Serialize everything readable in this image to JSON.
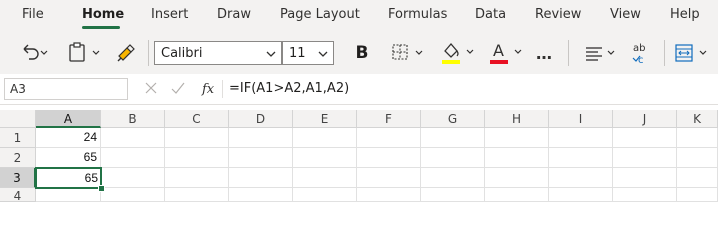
{
  "menu": {
    "items": [
      {
        "label": "File"
      },
      {
        "label": "Home"
      },
      {
        "label": "Insert"
      },
      {
        "label": "Draw"
      },
      {
        "label": "Page Layout"
      },
      {
        "label": "Formulas"
      },
      {
        "label": "Data"
      },
      {
        "label": "Review"
      },
      {
        "label": "View"
      },
      {
        "label": "Help"
      }
    ],
    "active": "Home"
  },
  "ribbon": {
    "font_name": "Calibri",
    "font_size": "11",
    "bold_label": "B",
    "font_color_label": "A",
    "more_label": "…",
    "fill_color": "#ffff00",
    "font_color": "#e81123",
    "icons": [
      "undo-icon",
      "paste-icon",
      "format-painter-icon",
      "bold-icon",
      "borders-icon",
      "fill-color-icon",
      "font-color-icon",
      "more-icon",
      "align-icon",
      "spelling-icon",
      "merge-icon"
    ]
  },
  "formula_bar": {
    "name_box": "A3",
    "fx_label": "fx",
    "formula": "=IF(A1>A2,A1,A2)"
  },
  "grid": {
    "columns": [
      "A",
      "B",
      "C",
      "D",
      "E",
      "F",
      "G",
      "H",
      "I",
      "J",
      "K"
    ],
    "rows": [
      "1",
      "2",
      "3",
      "4"
    ],
    "cells": {
      "A1": "24",
      "A2": "65",
      "A3": "65"
    },
    "selected_cell": "A3",
    "accent_color": "#217346"
  }
}
